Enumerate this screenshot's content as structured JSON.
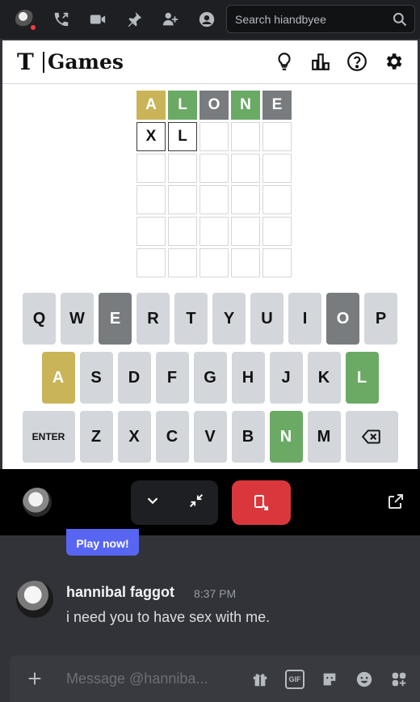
{
  "topbar": {
    "search_placeholder": "Search hiandbyee"
  },
  "game": {
    "logo_mark": "T",
    "logo_text": "Games",
    "rows": [
      [
        {
          "l": "A",
          "s": "present"
        },
        {
          "l": "L",
          "s": "correct"
        },
        {
          "l": "O",
          "s": "absent"
        },
        {
          "l": "N",
          "s": "correct"
        },
        {
          "l": "E",
          "s": "absent"
        }
      ],
      [
        {
          "l": "X",
          "s": "filled"
        },
        {
          "l": "L",
          "s": "filled"
        },
        {
          "l": "",
          "s": "empty"
        },
        {
          "l": "",
          "s": "empty"
        },
        {
          "l": "",
          "s": "empty"
        }
      ],
      [
        {
          "l": "",
          "s": "empty"
        },
        {
          "l": "",
          "s": "empty"
        },
        {
          "l": "",
          "s": "empty"
        },
        {
          "l": "",
          "s": "empty"
        },
        {
          "l": "",
          "s": "empty"
        }
      ],
      [
        {
          "l": "",
          "s": "empty"
        },
        {
          "l": "",
          "s": "empty"
        },
        {
          "l": "",
          "s": "empty"
        },
        {
          "l": "",
          "s": "empty"
        },
        {
          "l": "",
          "s": "empty"
        }
      ],
      [
        {
          "l": "",
          "s": "empty"
        },
        {
          "l": "",
          "s": "empty"
        },
        {
          "l": "",
          "s": "empty"
        },
        {
          "l": "",
          "s": "empty"
        },
        {
          "l": "",
          "s": "empty"
        }
      ],
      [
        {
          "l": "",
          "s": "empty"
        },
        {
          "l": "",
          "s": "empty"
        },
        {
          "l": "",
          "s": "empty"
        },
        {
          "l": "",
          "s": "empty"
        },
        {
          "l": "",
          "s": "empty"
        }
      ]
    ],
    "keyboard": [
      [
        {
          "k": "Q"
        },
        {
          "k": "W"
        },
        {
          "k": "E",
          "s": "absent"
        },
        {
          "k": "R"
        },
        {
          "k": "T"
        },
        {
          "k": "Y"
        },
        {
          "k": "U"
        },
        {
          "k": "I"
        },
        {
          "k": "O",
          "s": "absent"
        },
        {
          "k": "P"
        }
      ],
      [
        {
          "k": "A",
          "s": "present"
        },
        {
          "k": "S"
        },
        {
          "k": "D"
        },
        {
          "k": "F"
        },
        {
          "k": "G"
        },
        {
          "k": "H"
        },
        {
          "k": "J"
        },
        {
          "k": "K"
        },
        {
          "k": "L",
          "s": "correct"
        }
      ],
      [
        {
          "k": "ENTER",
          "wide": true
        },
        {
          "k": "Z"
        },
        {
          "k": "X"
        },
        {
          "k": "C"
        },
        {
          "k": "V"
        },
        {
          "k": "B"
        },
        {
          "k": "N",
          "s": "correct"
        },
        {
          "k": "M"
        },
        {
          "k": "backspace-icon",
          "wide": true,
          "icon": true
        }
      ]
    ]
  },
  "chat": {
    "play_label": "Play now!",
    "username": "hannibal faggot",
    "time": "8:37 PM",
    "message": "i need you to have sex with me.",
    "composer_placeholder": "Message @hanniba..."
  },
  "colors": {
    "present": "#c9b458",
    "correct": "#6aaa64",
    "absent": "#787c7e",
    "leave": "#da373c",
    "blurple": "#5865f2"
  }
}
